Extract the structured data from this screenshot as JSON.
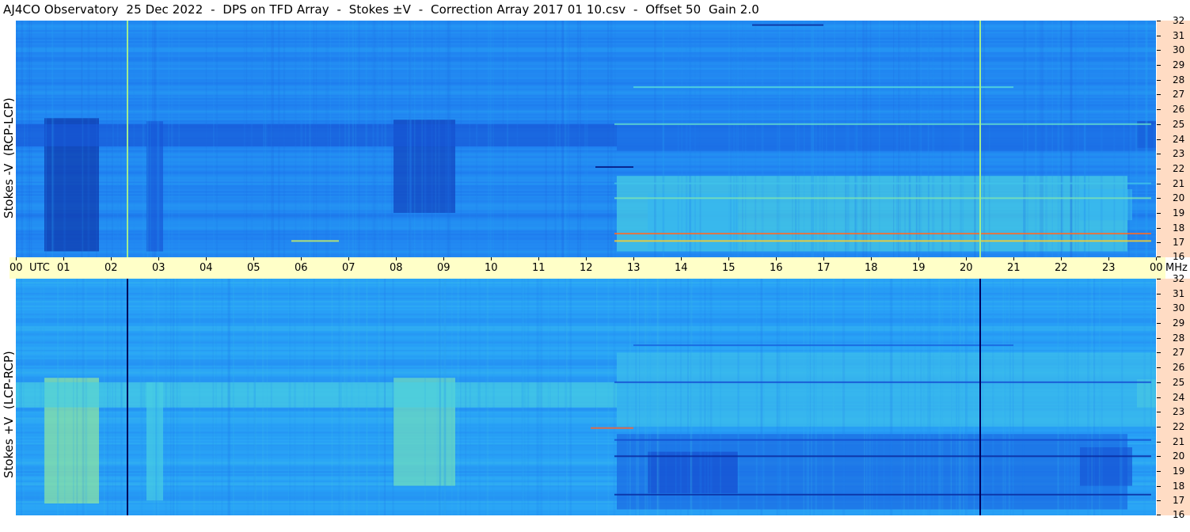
{
  "header": {
    "title": "AJ4CO Observatory  25 Dec 2022  -  DPS on TFD Array  -  Stokes ±V  -  Correction Array 2017 01 10.csv  -  Offset 50  Gain 2.0"
  },
  "colors": {
    "frame_bg": "#ffffff",
    "time_band": "#ffffc8",
    "freq_band": "#ffdcc4",
    "colormap": [
      "#00005a",
      "#0a2a9c",
      "#1550d2",
      "#1f7ef0",
      "#2aa8f6",
      "#4ed4e0",
      "#a6ee8a",
      "#ffef2c",
      "#ff7a1a",
      "#ff2050"
    ]
  },
  "chart_data": [
    {
      "type": "heatmap",
      "panel": "top",
      "ylabel": "Stokes -V  (RCP-LCP)",
      "x_unit": "UTC",
      "y_unit": "MHz",
      "xlim": [
        0,
        24
      ],
      "ylim": [
        16,
        32
      ],
      "x_tick_labels": [
        "00",
        "01",
        "02",
        "03",
        "04",
        "05",
        "06",
        "07",
        "08",
        "09",
        "10",
        "11",
        "12",
        "13",
        "14",
        "15",
        "16",
        "17",
        "18",
        "19",
        "20",
        "21",
        "22",
        "23",
        "00"
      ],
      "y_tick_labels": [
        "16",
        "17",
        "18",
        "19",
        "20",
        "21",
        "22",
        "23",
        "24",
        "25",
        "26",
        "27",
        "28",
        "29",
        "30",
        "31",
        "32"
      ],
      "baseline": 0.36,
      "bands": [
        {
          "x": [
            0.6,
            1.75
          ],
          "y": [
            16.4,
            25.4
          ],
          "v": -0.22
        },
        {
          "x": [
            2.75,
            3.1
          ],
          "y": [
            16.4,
            25.2
          ],
          "v": -0.12
        },
        {
          "x": [
            7.95,
            9.25
          ],
          "y": [
            19.0,
            25.3
          ],
          "v": -0.18
        },
        {
          "x": [
            0,
            12.65
          ],
          "y": [
            23.5,
            25.0
          ],
          "v": -0.12
        },
        {
          "x": [
            23.6,
            24
          ],
          "y": [
            23.4,
            25.2
          ],
          "v": -0.16
        },
        {
          "x": [
            12.65,
            23.4
          ],
          "y": [
            16.4,
            21.5
          ],
          "v": 0.18
        },
        {
          "x": [
            13.3,
            15.2
          ],
          "y": [
            16.5,
            20.3
          ],
          "v": 0.12
        },
        {
          "x": [
            22.4,
            23.5
          ],
          "y": [
            18.5,
            20.6
          ],
          "v": 0.12
        },
        {
          "x": [
            12.65,
            24
          ],
          "y": [
            23.2,
            25.0
          ],
          "v": -0.08
        }
      ],
      "lines": [
        {
          "x": [
            12.6,
            23.9
          ],
          "y": 17.6,
          "v": 0.55
        },
        {
          "x": [
            12.6,
            23.9
          ],
          "y": 17.1,
          "v": 0.45
        },
        {
          "x": [
            5.8,
            6.8
          ],
          "y": 17.1,
          "v": 0.35
        },
        {
          "x": [
            12.6,
            23.9
          ],
          "y": 25.0,
          "v": 0.22
        },
        {
          "x": [
            12.6,
            23.9
          ],
          "y": 20.0,
          "v": 0.25
        },
        {
          "x": [
            13.0,
            21.0
          ],
          "y": 27.5,
          "v": 0.2
        },
        {
          "x": [
            12.2,
            13.0
          ],
          "y": 22.1,
          "v": -0.3
        },
        {
          "x": [
            15.5,
            17.0
          ],
          "y": 31.7,
          "v": -0.25
        },
        {
          "x": [
            12.6,
            23.9
          ],
          "y": 21.0,
          "v": 0.15
        }
      ],
      "vlines": [
        {
          "x": 2.35,
          "v": 0.3
        },
        {
          "x": 20.3,
          "v": 0.3
        }
      ]
    },
    {
      "type": "heatmap",
      "panel": "bottom",
      "ylabel": "Stokes +V  (LCP-RCP)",
      "x_unit": "UTC",
      "y_unit": "MHz",
      "xlim": [
        0,
        24
      ],
      "ylim": [
        16,
        32
      ],
      "x_tick_labels": [
        "00",
        "01",
        "02",
        "03",
        "04",
        "05",
        "06",
        "07",
        "08",
        "09",
        "10",
        "11",
        "12",
        "13",
        "14",
        "15",
        "16",
        "17",
        "18",
        "19",
        "20",
        "21",
        "22",
        "23",
        "00"
      ],
      "y_tick_labels": [
        "16",
        "17",
        "18",
        "19",
        "20",
        "21",
        "22",
        "23",
        "24",
        "25",
        "26",
        "27",
        "28",
        "29",
        "30",
        "31",
        "32"
      ],
      "baseline": 0.42,
      "bands": [
        {
          "x": [
            0.6,
            1.75
          ],
          "y": [
            16.8,
            25.3
          ],
          "v": 0.22
        },
        {
          "x": [
            2.75,
            3.1
          ],
          "y": [
            17.0,
            25.0
          ],
          "v": 0.12
        },
        {
          "x": [
            7.95,
            9.25
          ],
          "y": [
            18.0,
            25.3
          ],
          "v": 0.18
        },
        {
          "x": [
            0,
            12.65
          ],
          "y": [
            23.3,
            25.0
          ],
          "v": 0.12
        },
        {
          "x": [
            23.6,
            24
          ],
          "y": [
            23.3,
            25.2
          ],
          "v": 0.16
        },
        {
          "x": [
            12.65,
            23.4
          ],
          "y": [
            16.4,
            21.5
          ],
          "v": -0.14
        },
        {
          "x": [
            13.3,
            15.2
          ],
          "y": [
            17.5,
            20.3
          ],
          "v": -0.2
        },
        {
          "x": [
            22.4,
            23.5
          ],
          "y": [
            18.0,
            20.6
          ],
          "v": -0.18
        },
        {
          "x": [
            12.65,
            24
          ],
          "y": [
            22.0,
            27.0
          ],
          "v": 0.08
        }
      ],
      "lines": [
        {
          "x": [
            12.6,
            23.9
          ],
          "y": 17.4,
          "v": -0.3
        },
        {
          "x": [
            12.6,
            23.9
          ],
          "y": 20.0,
          "v": -0.3
        },
        {
          "x": [
            12.6,
            23.9
          ],
          "y": 25.0,
          "v": -0.2
        },
        {
          "x": [
            12.1,
            13.0
          ],
          "y": 21.9,
          "v": 0.5
        },
        {
          "x": [
            12.6,
            23.9
          ],
          "y": 21.1,
          "v": -0.2
        },
        {
          "x": [
            13.0,
            21.0
          ],
          "y": 27.5,
          "v": -0.15
        }
      ],
      "vlines": [
        {
          "x": 2.35,
          "v": -0.42
        },
        {
          "x": 20.3,
          "v": -0.42
        }
      ]
    }
  ],
  "x_axis": {
    "labels": [
      "00",
      "01",
      "02",
      "03",
      "04",
      "05",
      "06",
      "07",
      "08",
      "09",
      "10",
      "11",
      "12",
      "13",
      "14",
      "15",
      "16",
      "17",
      "18",
      "19",
      "20",
      "21",
      "22",
      "23",
      "00"
    ],
    "unit_label": "UTC",
    "freq_unit_label": "MHz"
  }
}
